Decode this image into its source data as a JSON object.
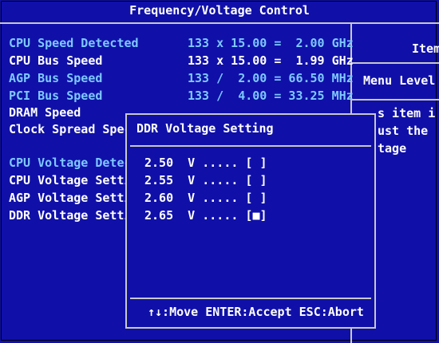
{
  "header": {
    "title": "Frequency/Voltage Control"
  },
  "settings": [
    {
      "label": "CPU Speed Detected",
      "value": "133 x 15.00 =  2.00 GHz",
      "color": "#7ec8ff"
    },
    {
      "label": "CPU Bus Speed",
      "value": "133 x 15.00 =  1.99 GHz",
      "color": "#ffffff"
    },
    {
      "label": "AGP Bus Speed",
      "value": "133 /  2.00 = 66.50 MHz",
      "color": "#7ec8ff"
    },
    {
      "label": "PCI Bus Speed",
      "value": "133 /  4.00 = 33.25 MHz",
      "color": "#7ec8ff"
    },
    {
      "label": "DRAM Speed",
      "value": "",
      "color": "#ffffff"
    },
    {
      "label": "Clock Spread Spec",
      "value": "",
      "color": "#ffffff"
    },
    {
      "label": "CPU Voltage Detec",
      "value": "",
      "color": "#7ec8ff"
    },
    {
      "label": "CPU Voltage Setti",
      "value": "",
      "color": "#ffffff"
    },
    {
      "label": "AGP Voltage Setti",
      "value": "",
      "color": "#ffffff"
    },
    {
      "label": "DDR Voltage Setti",
      "value": "",
      "color": "#ffffff"
    }
  ],
  "help": {
    "title": "Item",
    "menu_level": "Menu Level",
    "lines": [
      "s item i",
      "ust the",
      "tage"
    ]
  },
  "popup": {
    "title": "DDR Voltage Setting",
    "options": [
      {
        "label": "2.50  V ..... [ ]",
        "selected": false
      },
      {
        "label": "2.55  V ..... [ ]",
        "selected": false
      },
      {
        "label": "2.60  V ..... [ ]",
        "selected": false
      },
      {
        "label": "2.65  V ..... [■]",
        "selected": true
      }
    ],
    "footer": "↑↓:Move ENTER:Accept ESC:Abort"
  },
  "colors": {
    "background": "#1010a8",
    "label_cyan": "#7ec8ff",
    "text": "#ffffff",
    "border": "#c8c8c8"
  }
}
